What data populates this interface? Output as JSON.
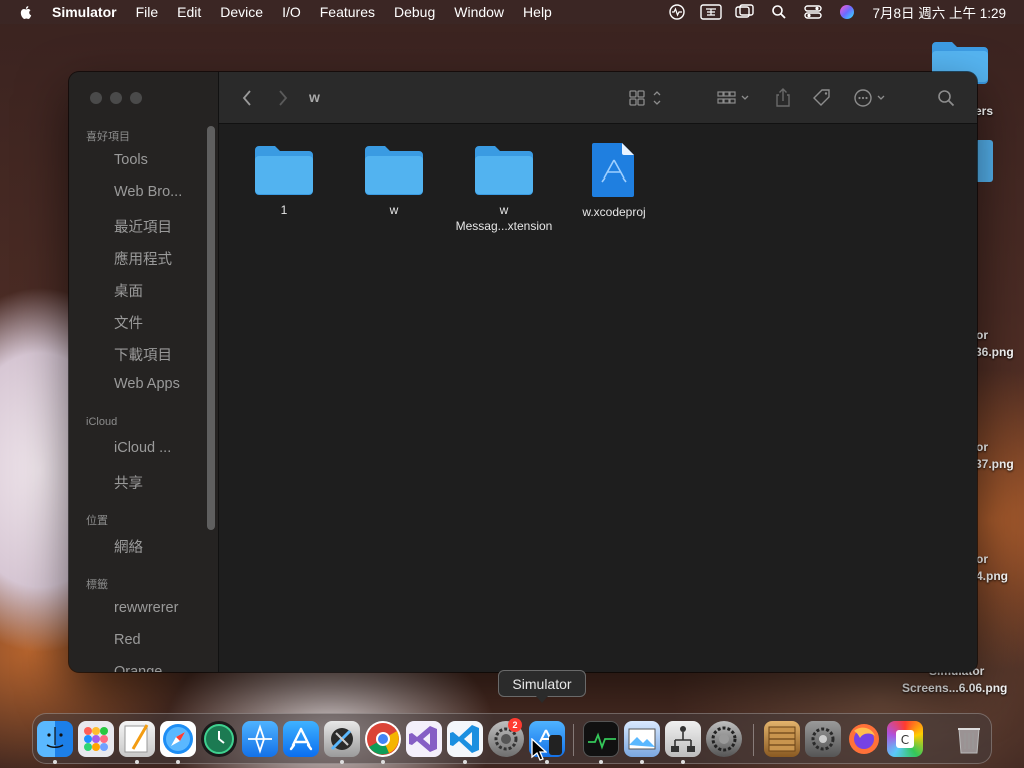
{
  "menubar": {
    "app_name": "Simulator",
    "items": [
      "File",
      "Edit",
      "Device",
      "I/O",
      "Features",
      "Debug",
      "Window",
      "Help"
    ],
    "clock": "7月8日 週六 上午 1:29",
    "status_icons": [
      "activity-monitor-icon",
      "input-method-icon",
      "screen-mirroring-icon",
      "spotlight-search-icon",
      "control-center-icon",
      "siri-icon"
    ]
  },
  "desktop": {
    "labels": [
      "ers",
      "or",
      "36.png",
      "or",
      "37.png",
      "or",
      "4.png",
      "Simulator",
      "Screens...6.06.png"
    ]
  },
  "finder": {
    "title": "w",
    "sidebar": {
      "favorites_header": "喜好項目",
      "favorites": [
        "Tools",
        "Web Bro...",
        "最近項目",
        "應用程式",
        "桌面",
        "文件",
        "下載項目",
        "Web Apps"
      ],
      "icloud_header": "iCloud",
      "icloud": [
        "iCloud ...",
        "共享"
      ],
      "locations_header": "位置",
      "locations": [
        "網絡"
      ],
      "tags_header": "標籤",
      "tags": [
        "rewwrerer",
        "Red",
        "Orange"
      ]
    },
    "files": [
      {
        "name_line1": "1",
        "name_line2": "",
        "type": "folder"
      },
      {
        "name_line1": "w",
        "name_line2": "",
        "type": "folder"
      },
      {
        "name_line1": "w",
        "name_line2": "Messag...xtension",
        "type": "folder"
      },
      {
        "name_line1": "w.xcodeproj",
        "name_line2": "",
        "type": "xcodeproj"
      }
    ]
  },
  "tooltip": "Simulator",
  "dock": {
    "badge_count": "2",
    "apps": [
      "finder",
      "launchpad",
      "pages",
      "safari",
      "time-machine",
      "testflight",
      "app-store",
      "xcode-instruments",
      "chrome",
      "visual-studio",
      "vscode",
      "system-settings",
      "simulator",
      "activity-monitor",
      "preview",
      "network-utility",
      "system-settings-2",
      "archive",
      "system-preferences",
      "firefox",
      "color-picker",
      "trash"
    ]
  },
  "colors": {
    "folder": "#4fb0ef",
    "accent": "#2e8ef2",
    "badge": "#ff3b30"
  }
}
